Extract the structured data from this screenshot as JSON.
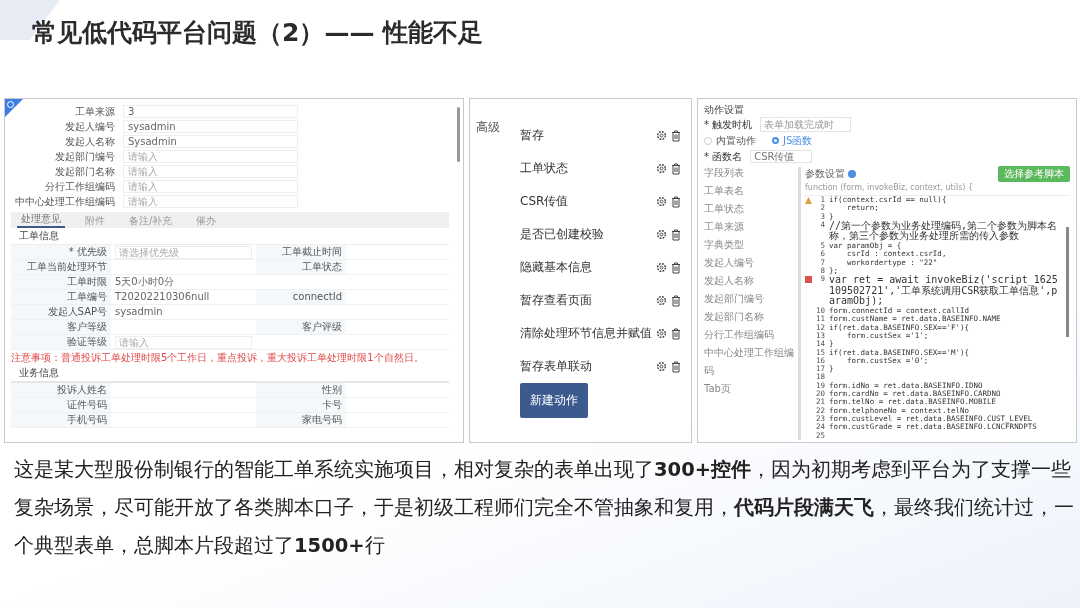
{
  "title": "常见低代码平台问题（2）—— 性能不足",
  "form_panel": {
    "header_fields": [
      {
        "label": "工单来源",
        "value": "3"
      },
      {
        "label": "发起人编号",
        "value": "sysadmin"
      },
      {
        "label": "发起人名称",
        "value": "Sysadmin"
      },
      {
        "label": "发起部门编号",
        "placeholder": "请输入"
      },
      {
        "label": "发起部门名称",
        "placeholder": "请输入"
      },
      {
        "label": "分行工作组编码",
        "placeholder": "请输入"
      },
      {
        "label": "中中心处理工作组编码",
        "placeholder": "请输入"
      }
    ],
    "tabs": [
      {
        "label": "处理意见",
        "selected": true
      },
      {
        "label": "附件",
        "selected": false
      },
      {
        "label": "备注/补充",
        "selected": false
      },
      {
        "label": "催办",
        "selected": false
      }
    ],
    "section_1": "工单信息",
    "rows_1": [
      [
        {
          "label": "* 优先级",
          "placeholder": "请选择优先级"
        },
        {
          "label": "工单截止时间"
        }
      ],
      [
        {
          "label": "工单当前处理环节"
        },
        {
          "label": "工单状态"
        }
      ],
      [
        {
          "label": "工单时限",
          "value": "5天0小时0分"
        }
      ],
      [
        {
          "label": "工单编号",
          "value": "T20202210306null"
        },
        {
          "label": "connectId"
        }
      ],
      [
        {
          "label": "发起人SAP号",
          "value": "sysadmin"
        }
      ],
      [
        {
          "label": "客户等级"
        },
        {
          "label": "客户评级"
        }
      ],
      [
        {
          "label": "验证等级",
          "placeholder": "请输入"
        }
      ]
    ],
    "notice": "注意事项：普通投诉工单处理时限5个工作日，重点投诉，重大投诉工单处理时限1个自然日。",
    "section_2": "业务信息",
    "rows_2": [
      [
        {
          "label": "投诉人姓名"
        },
        {
          "label": "性别"
        }
      ],
      [
        {
          "label": "证件号码"
        },
        {
          "label": "卡号"
        }
      ],
      [
        {
          "label": "手机号码"
        },
        {
          "label": "家电号码"
        }
      ]
    ]
  },
  "actions_panel": {
    "group": "高级",
    "actions": [
      "暂存",
      "工单状态",
      "CSR传值",
      "是否已创建校验",
      "隐藏基本信息",
      "暂存查看页面",
      "清除处理环节信息并赋值",
      "暂存表单联动"
    ],
    "new_button": "新建动作"
  },
  "settings_panel": {
    "title": "动作设置",
    "trigger_label": "* 触发时机",
    "trigger_value": "表单加载完成时",
    "modes": [
      {
        "label": "内置动作",
        "selected": false
      },
      {
        "label": "JS函数",
        "selected": true
      }
    ],
    "name_label": "* 函数名",
    "name_value": "CSR传值",
    "field_list_title": "字段列表",
    "field_list": [
      "工单表名",
      "工单状态",
      "工单来源",
      "字典类型",
      "发起人编号",
      "发起人名称",
      "发起部门编号",
      "发起部门名称",
      "分行工作组编码",
      "中中心处理工作组编",
      "码",
      "Tab页"
    ],
    "params_title": "参数设置",
    "signature": "function (form, invokeBiz, context, utils) {",
    "script_button": "选择参考脚本",
    "code": [
      {
        "no": "1",
        "text": "if(context.csrId == null){",
        "kind": "warning"
      },
      {
        "no": "2",
        "text": "    return;"
      },
      {
        "no": "3",
        "text": "}"
      },
      {
        "no": "4",
        "text": "//第一个参数为业务处理编码,第二个参数为脚本名称，第三个参数为业务处理所需的传入参数"
      },
      {
        "no": "5",
        "text": "var paramObj = {"
      },
      {
        "no": "6",
        "text": "    csrId : context.csrId,"
      },
      {
        "no": "7",
        "text": "    workordertype : \"22\""
      },
      {
        "no": "8",
        "text": "};"
      },
      {
        "no": "9",
        "text": "var ret = await invokeBiz('script_1625109502721','工单系统调用CSR获取工单信息',paramObj);",
        "kind": "error"
      },
      {
        "no": "10",
        "text": "form.connectId = context.callId"
      },
      {
        "no": "11",
        "text": "form.custName = ret.data.BASEINFO.NAME"
      },
      {
        "no": "12",
        "text": "if(ret.data.BASEINFO.SEX=='F'){"
      },
      {
        "no": "13",
        "text": "    form.custSex ='1';"
      },
      {
        "no": "14",
        "text": "}"
      },
      {
        "no": "15",
        "text": "if(ret.data.BASEINFO.SEX=='M'){"
      },
      {
        "no": "16",
        "text": "    form.custSex ='0';"
      },
      {
        "no": "17",
        "text": "}"
      },
      {
        "no": "18"
      },
      {
        "no": "19",
        "text": "form.idNo = ret.data.BASEINFO.IDNO"
      },
      {
        "no": "20",
        "text": "form.cardNo = ret.data.BASEINFO.CARDNO"
      },
      {
        "no": "21",
        "text": "form.telNo = ret.data.BASEINFO.MOBILE"
      },
      {
        "no": "22",
        "text": "form.telphoneNo = context.telNo"
      },
      {
        "no": "23",
        "text": "form.custLevel = ret.data.BASEINFO.CUST_LEVEL"
      },
      {
        "no": "24",
        "text": "form.custGrade = ret.data.BASEINFO.LCNCFRNDPTS"
      },
      {
        "no": "25"
      }
    ]
  },
  "paragraph": "这是某大型股份制银行的智能工单系统实施项目，相对复杂的表单出现了**300+控件**，因为初期考虑到平台为了支撑一些复杂场景，尽可能开放了各类脚本口子，于是初级工程师们完全不管抽象和复用，**代码片段满天飞**，最终我们统计过，一个典型表单，总脚本片段超过了**1500+**行"
}
